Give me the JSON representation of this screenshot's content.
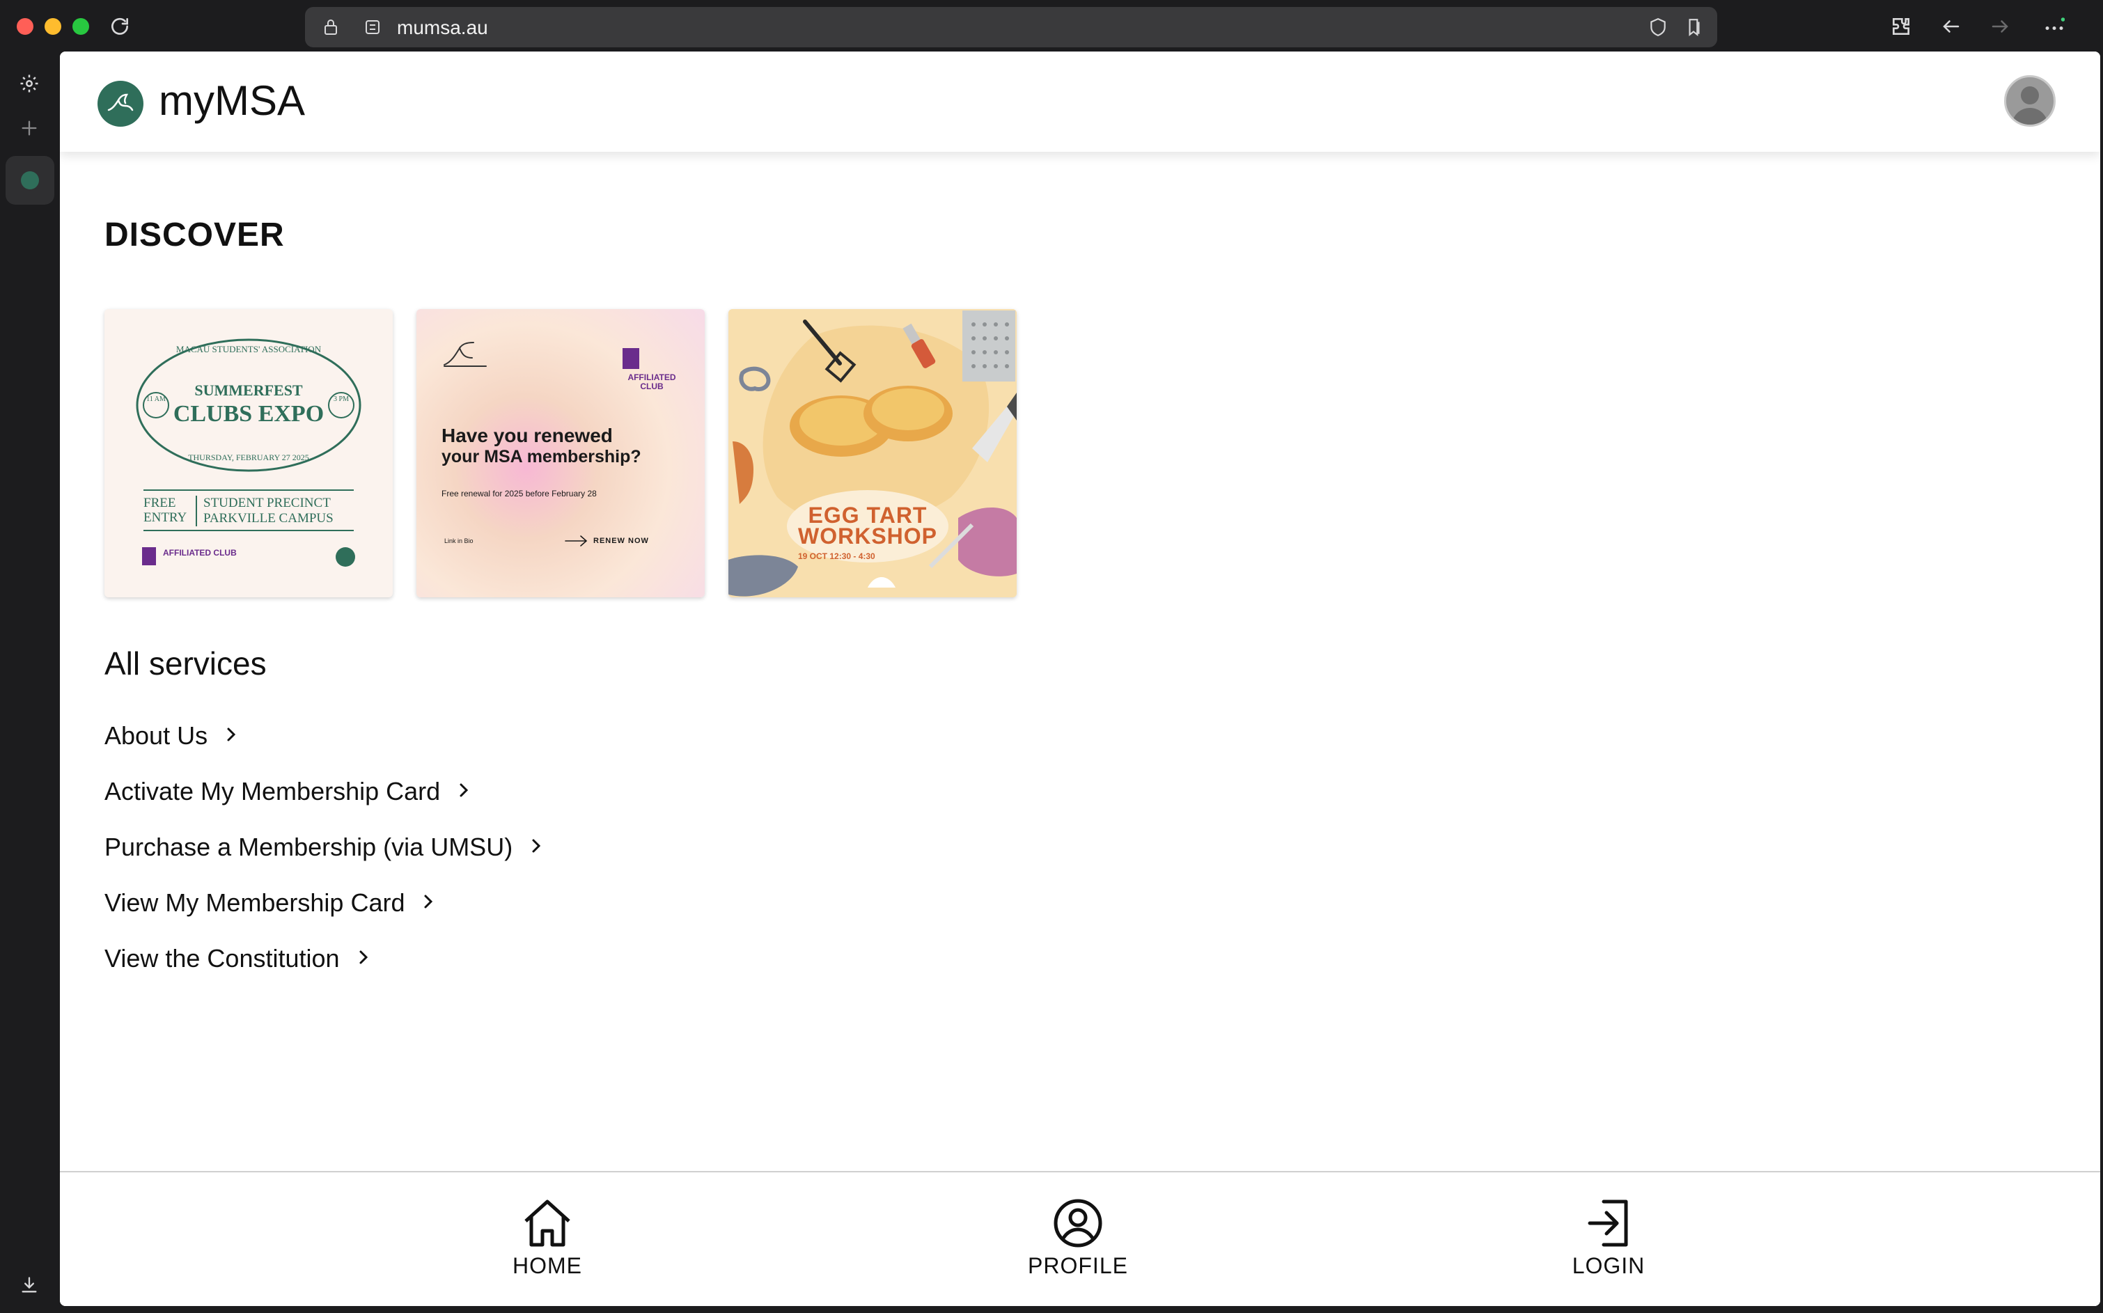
{
  "browser": {
    "url": "mumsa.au"
  },
  "header": {
    "brand": "myMSA"
  },
  "discover": {
    "title": "DISCOVER",
    "tiles": [
      {
        "org": "MACAU STUDENTS' ASSOCIATION",
        "line1": "SUMMERFEST",
        "line2": "CLUBS EXPO",
        "time_start": "11 AM",
        "time_end": "3 PM",
        "date": "THURSDAY, FEBRUARY 27 2025",
        "entry": "FREE ENTRY",
        "venue1": "STUDENT PRECINCT",
        "venue2": "PARKVILLE CAMPUS",
        "badge": "AFFILIATED CLUB"
      },
      {
        "headline1": "Have you renewed",
        "headline2": "your MSA membership?",
        "sub": "Free renewal for 2025 before February 28",
        "link": "Link in Bio",
        "cta": "RENEW NOW",
        "badge": "AFFILIATED CLUB"
      },
      {
        "title1": "EGG TART",
        "title2": "WORKSHOP",
        "when": "19 OCT  12:30 - 4:30"
      }
    ]
  },
  "services": {
    "title": "All services",
    "items": [
      {
        "label": "About Us"
      },
      {
        "label": "Activate My Membership Card"
      },
      {
        "label": "Purchase a Membership (via UMSU)"
      },
      {
        "label": "View My Membership Card"
      },
      {
        "label": "View the Constitution"
      }
    ]
  },
  "nav": {
    "home": "HOME",
    "profile": "PROFILE",
    "login": "LOGIN"
  },
  "colors": {
    "brand_green": "#2f6e5a",
    "text": "#111111"
  }
}
